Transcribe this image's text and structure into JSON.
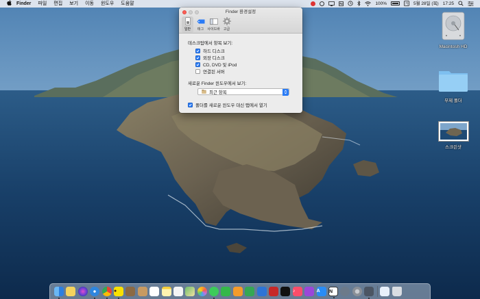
{
  "menubar": {
    "app_name": "Finder",
    "items": [
      "파일",
      "편집",
      "보기",
      "이동",
      "윈도우",
      "도움말"
    ],
    "wifi": "WiFi",
    "battery_percent": "100%",
    "date": "5월 28일 (목)",
    "time": "17:25"
  },
  "prefs": {
    "title": "Finder 환경설정",
    "tabs": [
      {
        "label": "일반",
        "icon": "switch-icon",
        "active": true
      },
      {
        "label": "태그",
        "icon": "tag-icon",
        "active": false
      },
      {
        "label": "사이드바",
        "icon": "sidebar-icon",
        "active": false
      },
      {
        "label": "고급",
        "icon": "gear-icon",
        "active": false
      }
    ],
    "desktop_section": {
      "label": "데스크탑에서 항목 보기:",
      "options": [
        {
          "label": "하드 디스크",
          "checked": true
        },
        {
          "label": "외장 디스크",
          "checked": true
        },
        {
          "label": "CD, DVD 및 iPod",
          "checked": true
        },
        {
          "label": "연결된 서버",
          "checked": false
        }
      ]
    },
    "new_window_section": {
      "label": "새로운 Finder 윈도우에서 보기:",
      "selected": "최근 항목"
    },
    "open_folders_tabs": {
      "label": "폴더를 새로운 윈도우 대신 탭에서 열기",
      "checked": true
    }
  },
  "desktop": {
    "icons": [
      {
        "label": "Macintosh HD",
        "icon": "hard-drive-icon"
      },
      {
        "label": "무제 폴더",
        "icon": "folder-icon"
      },
      {
        "label": "스크린샷",
        "icon": "screenshot-thumbnail"
      }
    ]
  },
  "dock": {
    "apps": [
      {
        "name": "finder",
        "color": "#3d8ee8",
        "running": true
      },
      {
        "name": "stickies",
        "color": "#f4d35e",
        "running": false
      },
      {
        "name": "siri",
        "color": "#5b3fd1",
        "running": false
      },
      {
        "name": "safari",
        "color": "#2e86de",
        "running": true
      },
      {
        "name": "chrome",
        "color": "#e94235",
        "running": true
      },
      {
        "name": "kakaotalk",
        "color": "#fae100",
        "running": true
      },
      {
        "name": "notebook",
        "color": "#8b6a44",
        "running": false
      },
      {
        "name": "contacts",
        "color": "#c79a62",
        "running": false
      },
      {
        "name": "calendar",
        "color": "#ffffff",
        "running": false
      },
      {
        "name": "notes",
        "color": "#fff3b0",
        "running": false
      },
      {
        "name": "reminders",
        "color": "#f5f5f5",
        "running": false
      },
      {
        "name": "maps",
        "color": "#6fbf6b",
        "running": false
      },
      {
        "name": "photos",
        "color": "#ffffff",
        "running": false
      },
      {
        "name": "messages",
        "color": "#3ccc5a",
        "running": true
      },
      {
        "name": "facetime",
        "color": "#35b84a",
        "running": false
      },
      {
        "name": "pages",
        "color": "#f59b2b",
        "running": false
      },
      {
        "name": "numbers",
        "color": "#35a853",
        "running": false
      },
      {
        "name": "keynote",
        "color": "#2d74d6",
        "running": false
      },
      {
        "name": "photo-booth",
        "color": "#c62828",
        "running": false
      },
      {
        "name": "tv",
        "color": "#111111",
        "running": false
      },
      {
        "name": "music",
        "color": "#fa4d6a",
        "running": false
      },
      {
        "name": "podcasts",
        "color": "#9b46d9",
        "running": false
      },
      {
        "name": "app-store",
        "color": "#2a8cf5",
        "running": false
      },
      {
        "name": "notion",
        "color": "#ffffff",
        "running": true
      },
      {
        "name": "launchpad",
        "color": "#6c7a8a",
        "running": false
      },
      {
        "name": "system-preferences",
        "color": "#8a8f96",
        "running": false
      },
      {
        "name": "screenshot",
        "color": "#4b5563",
        "running": true
      }
    ],
    "right": [
      {
        "name": "downloads",
        "color": "#e8f0fa"
      },
      {
        "name": "trash",
        "color": "#d9dde2"
      }
    ]
  }
}
